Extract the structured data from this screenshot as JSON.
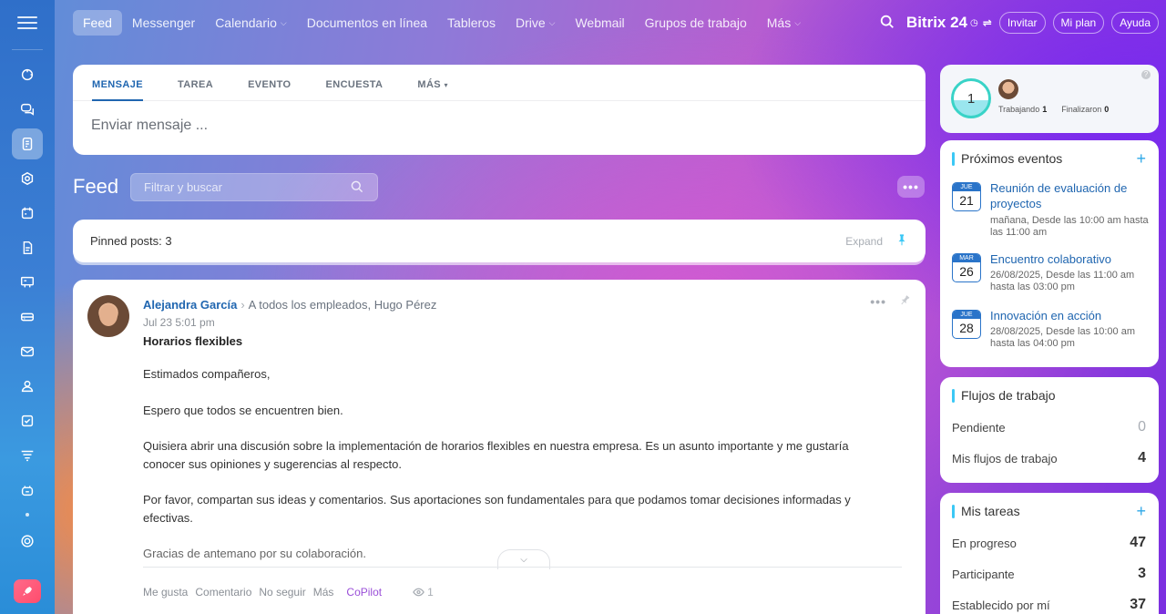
{
  "rail": {
    "icons": [
      "menu-icon",
      "activity-icon",
      "chat-icon",
      "feed-icon",
      "hexagon-icon",
      "calendar-icon",
      "document-icon",
      "board-icon",
      "drive-icon",
      "mail-icon",
      "groups-icon",
      "tasks-icon",
      "filter-icon",
      "bot-icon",
      "settings-icon",
      "rocket-icon"
    ]
  },
  "nav": {
    "items": [
      {
        "label": "Feed",
        "active": true,
        "dropdown": false
      },
      {
        "label": "Messenger",
        "dropdown": false
      },
      {
        "label": "Calendario",
        "dropdown": true
      },
      {
        "label": "Documentos en línea",
        "dropdown": false
      },
      {
        "label": "Tableros",
        "dropdown": false
      },
      {
        "label": "Drive",
        "dropdown": true
      },
      {
        "label": "Webmail",
        "dropdown": false
      },
      {
        "label": "Grupos de trabajo",
        "dropdown": false
      },
      {
        "label": "Más",
        "dropdown": true
      }
    ],
    "brand": "Bitrix 24",
    "invite": "Invitar",
    "plan": "Mi plan",
    "help": "Ayuda"
  },
  "composer": {
    "tabs": [
      "MENSAJE",
      "TAREA",
      "EVENTO",
      "ENCUESTA",
      "MÁS"
    ],
    "placeholder": "Enviar mensaje ..."
  },
  "feed": {
    "title": "Feed",
    "search_placeholder": "Filtrar y buscar",
    "pinned_label": "Pinned posts: 3",
    "expand": "Expand"
  },
  "post": {
    "author": "Alejandra García",
    "recipients": "A todos los empleados, Hugo Pérez",
    "date": "Jul 23 5:01 pm",
    "title": "Horarios flexibles",
    "paragraphs": [
      "Estimados compañeros,",
      "Espero que todos se encuentren bien.",
      "Quisiera abrir una discusión sobre la implementación de horarios flexibles en nuestra empresa. Es un asunto importante y me gustaría conocer sus opiniones y sugerencias al respecto.",
      "Por favor, compartan sus ideas y comentarios. Sus aportaciones son fundamentales para que podamos tomar decisiones informadas y efectivas.",
      "Gracias de antemano por su colaboración."
    ],
    "actions": [
      "Me gusta",
      "Comentario",
      "No seguir",
      "Más"
    ],
    "copilot": "CoPilot",
    "views": "1"
  },
  "status": {
    "count": "1",
    "working_label": "Trabajando",
    "working_value": "1",
    "finished_label": "Finalizaron",
    "finished_value": "0",
    "help": "?"
  },
  "events": {
    "title": "Próximos eventos",
    "items": [
      {
        "dow": "JUE",
        "day": "21",
        "title": "Reunión de evaluación de proyectos",
        "time": "mañana, Desde las 10:00 am hasta las 11:00 am"
      },
      {
        "dow": "MAR",
        "day": "26",
        "title": "Encuentro colaborativo",
        "time": "26/08/2025, Desde las 11:00 am hasta las 03:00 pm"
      },
      {
        "dow": "JUE",
        "day": "28",
        "title": "Innovación en acción",
        "time": "28/08/2025, Desde las 10:00 am hasta las 04:00 pm"
      }
    ]
  },
  "workflows": {
    "title": "Flujos de trabajo",
    "rows": [
      {
        "label": "Pendiente",
        "value": "0"
      },
      {
        "label": "Mis flujos de trabajo",
        "value": "4"
      }
    ]
  },
  "tasks": {
    "title": "Mis tareas",
    "rows": [
      {
        "label": "En progreso",
        "value": "47"
      },
      {
        "label": "Participante",
        "value": "3"
      },
      {
        "label": "Establecido por mí",
        "value": "37"
      }
    ]
  }
}
